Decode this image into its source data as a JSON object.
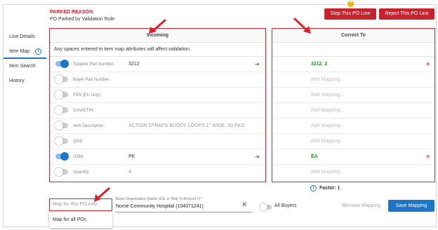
{
  "help_badge": "?",
  "sidebar": {
    "items": [
      {
        "label": "Line Details"
      },
      {
        "label": "Item Map",
        "info": "i"
      },
      {
        "label": "Item Search"
      },
      {
        "label": "History"
      }
    ]
  },
  "header": {
    "parked_reason_title": "PARKED REASON:",
    "parked_reason_text": "PO Parked by Validation Rule",
    "stop_button": "Stop This PO Line",
    "reject_button": "Reject This PO Line"
  },
  "incoming": {
    "title": "Incoming",
    "notice": "Any spaces entered in item map attributes will affect validation.",
    "rows": [
      {
        "label": "Supplier Part Number:",
        "value": "3212",
        "toggle_on": true,
        "arrow": "➔"
      },
      {
        "label": "Buyer Part Number:",
        "value": "",
        "toggle_on": false
      },
      {
        "label": "PZN (EU only):",
        "value": "",
        "toggle_on": false
      },
      {
        "label": "EAN/GTIN:",
        "value": "",
        "toggle_on": false
      },
      {
        "label": "Item Description:",
        "value": "ACTION STRAPS BUDDY LOOPS 1\" WIDE, 50 PKG",
        "toggle_on": false
      },
      {
        "label": "QOE:",
        "value": "",
        "toggle_on": false
      },
      {
        "label": "UOM:",
        "value": "PK",
        "toggle_on": true,
        "arrow": "➔"
      },
      {
        "label": "Quantity:",
        "value": "4",
        "toggle_on": false
      }
    ]
  },
  "correct_to": {
    "title": "Correct To",
    "rows": [
      {
        "value": "3212_2",
        "clear": "✕"
      },
      {
        "placeholder": "Add Mapping..."
      },
      {
        "placeholder": "Add Mapping..."
      },
      {
        "placeholder": "Add Mapping..."
      },
      {
        "placeholder": "Add Mapping..."
      },
      {
        "placeholder": "Add Mapping..."
      },
      {
        "value": "EA",
        "clear": "✕"
      },
      {
        "placeholder": "Add Mapping..."
      }
    ]
  },
  "factor": {
    "icon": "i",
    "label": "Factor: 1"
  },
  "footer": {
    "map_scope_placeholder": "Map for this PO only",
    "map_scope_option": "Map for all POs",
    "buyer_label": "Buyer Organization (Name, ESL or Ship To Account #) *",
    "buyer_value": "Nome Community Hospital (104071241)",
    "clear_icon": "✕",
    "all_buyers": "All Buyers",
    "remove_mapping": "Remove Mapping",
    "save_mapping": "Save Mapping"
  },
  "colors": {
    "accent_blue": "#1e74c9",
    "danger_red": "#c7232e",
    "highlight_red": "#d8232f",
    "success_green": "#2a8d2a",
    "help_yellow": "#f2b400"
  }
}
